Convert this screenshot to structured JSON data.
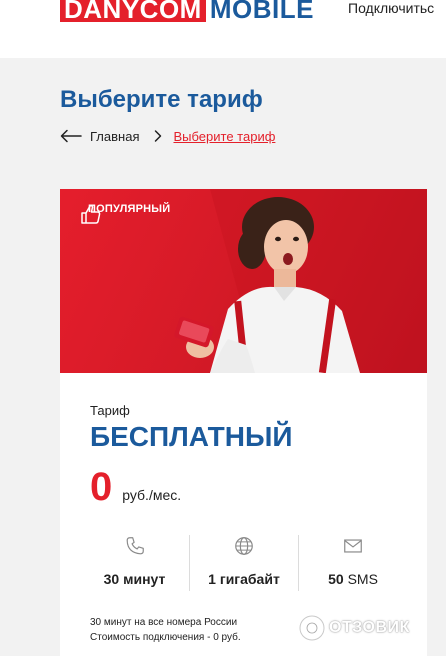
{
  "header": {
    "logo_left": "DANYCOM",
    "logo_right": "MOBILE",
    "connect_link": "Подключитьс"
  },
  "page": {
    "title": "Выберите тариф"
  },
  "breadcrumb": {
    "home": "Главная",
    "current": "Выберите тариф"
  },
  "card": {
    "badge": "ПОПУЛЯРНЫЙ",
    "tariff_label": "Тариф",
    "tariff_name": "БЕСПЛАТНЫЙ",
    "price_value": "0",
    "price_unit": "руб./мес.",
    "features": [
      {
        "icon": "phone-icon",
        "value": "30",
        "unit": "минут"
      },
      {
        "icon": "globe-icon",
        "value": "1",
        "unit": "гигабайт"
      },
      {
        "icon": "mail-icon",
        "value": "50",
        "unit": "SMS"
      }
    ],
    "notes": [
      "30 минут на все номера России",
      "Стоимость подключения - 0 руб."
    ]
  },
  "watermark": {
    "text": "ОТЗОВИК"
  },
  "colors": {
    "brand_red": "#e4202b",
    "brand_blue": "#1b5a9c"
  }
}
